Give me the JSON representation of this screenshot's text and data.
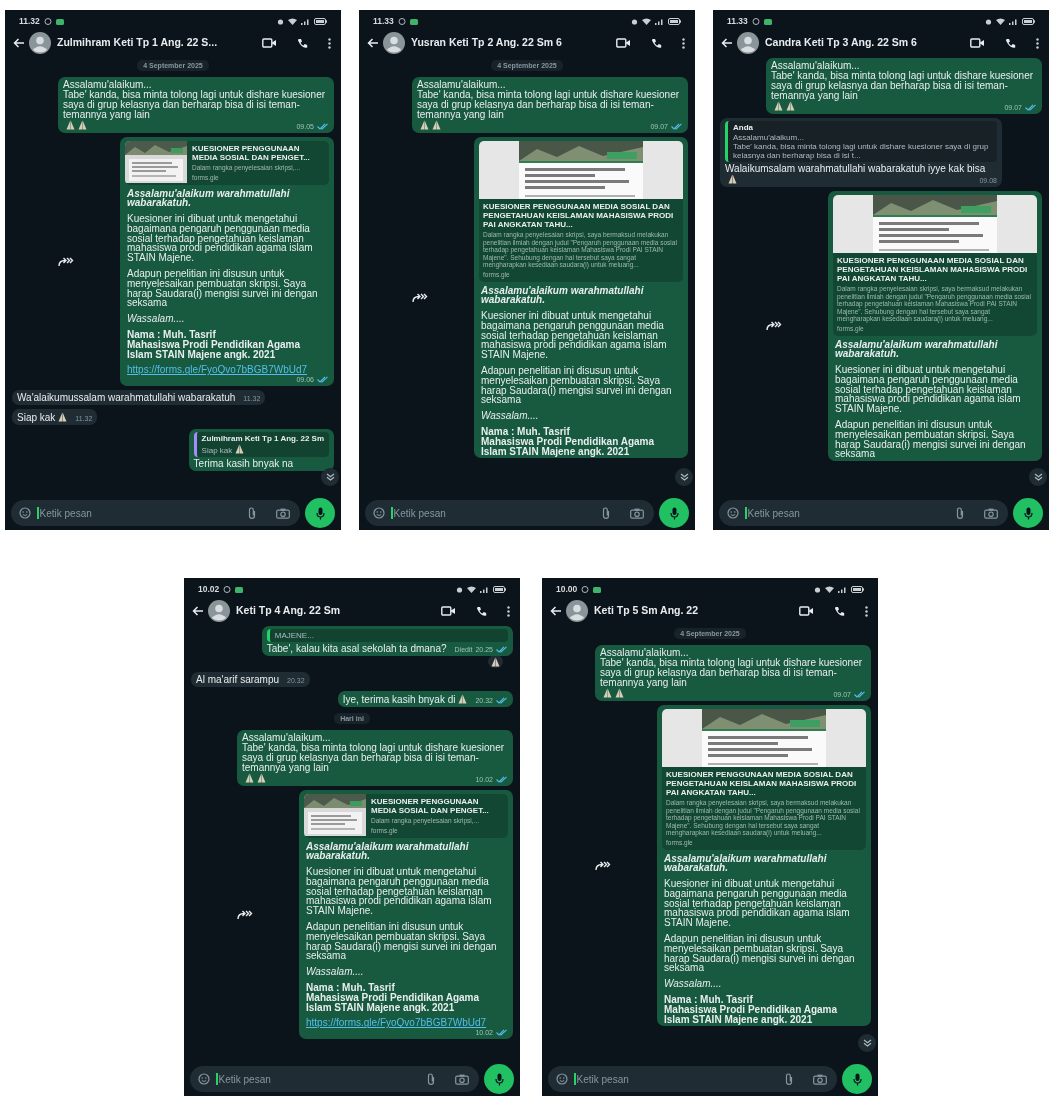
{
  "phones": [
    {
      "status_time": "11.32",
      "contact": "Zulmihram Keti Tp 1 Ang. 22 S...",
      "scroll_button": true,
      "placeholder": "Ketik pesan",
      "messages": [
        {
          "kind": "date",
          "text": "4 September 2025"
        },
        {
          "kind": "text",
          "outgoing": true,
          "text": "Assalamu'alaikum...\nTabe' kanda, bisa minta tolong lagi untuk dishare kuesioner saya di grup kelasnya dan berharap bisa di isi teman-temannya yang lain",
          "emojis": [
            {
              "kind": "pray"
            },
            {
              "kind": "pray"
            }
          ],
          "time": "09.05",
          "read": true
        },
        {
          "kind": "link",
          "outgoing": true,
          "forwarded": true,
          "preview": {
            "kind": "small",
            "title": "KUESIONER PENGGUNAAN MEDIA SOSIAL DAN PENGET...",
            "description": "Dalam rangka penyelesaian skripsi,...",
            "domain": "forms.gle"
          },
          "paragraphs": [
            {
              "kind": "greeting",
              "text": "Assalamu'alaikum warahmatullahi wabarakatuh."
            },
            {
              "kind": "body",
              "text": "Kuesioner ini dibuat untuk mengetahui bagaimana pengaruh penggunaan media sosial terhadap pengetahuan keislaman mahasiswa prodi pendidikan agama islam STAIN Majene."
            },
            {
              "kind": "body",
              "text": "Adapun penelitian ini disusun untuk menyelesaikan pembuatan skripsi. Saya harap Saudara(i) mengisi survei ini dengan seksama"
            },
            {
              "kind": "closing",
              "text": "Wassalam...."
            },
            {
              "kind": "signature",
              "text": "Nama : Muh. Tasrif\nMahasiswa Prodi Pendidikan Agama Islam STAIN Majene angk. 2021"
            }
          ],
          "url": "https://forms.gle/FyoQvo7bBGB7WbUd7",
          "time": "09.06",
          "read": true
        },
        {
          "kind": "text",
          "outgoing": false,
          "text": "Wa'alaikumussalam warahmatullahi wabarakatuh",
          "time": "11.32"
        },
        {
          "kind": "text",
          "outgoing": false,
          "text": "Siap kak",
          "emojis": [
            {
              "kind": "pray"
            }
          ],
          "time": "11.32"
        },
        {
          "kind": "text",
          "outgoing": true,
          "quote": {
            "author": "Zulmihram Keti Tp 1 Ang. 22 Sm",
            "text": "Siap kak",
            "emojis": [
              {
                "kind": "pray"
              }
            ],
            "color": "#a78bfa"
          },
          "text": "Terima kasih bnyak na"
        }
      ]
    },
    {
      "status_time": "11.33",
      "contact": "Yusran Keti Tp 2 Ang. 22 Sm 6",
      "scroll_button": true,
      "placeholder": "Ketik pesan",
      "messages": [
        {
          "kind": "date",
          "text": "4 September 2025"
        },
        {
          "kind": "text",
          "outgoing": true,
          "text": "Assalamu'alaikum...\nTabe' kanda, bisa minta tolong lagi untuk dishare kuesioner saya di grup kelasnya dan berharap bisa di isi teman-temannya yang lain",
          "emojis": [
            {
              "kind": "pray"
            },
            {
              "kind": "pray"
            }
          ],
          "time": "09.07",
          "read": true
        },
        {
          "kind": "link",
          "outgoing": true,
          "forwarded": true,
          "preview": {
            "kind": "large",
            "title": "KUESIONER PENGGUNAAN MEDIA SOSIAL DAN PENGETAHUAN KEISLAMAN MAHASISWA PRODI PAI ANGKATAN TAHU...",
            "description": "Dalam rangka penyelesaian skripsi, saya bermaksud melakukan penelitian ilmiah dengan judul \"Pengaruh penggunaan media sosial terhadap pengetahuan keislaman Mahasiswa Prodi PAI STAIN Majene\". Sehubung dengan hal tersebut saya sangat mengharapkan kesediaan saudara(i) untuk meluang...",
            "domain": "forms.gle"
          },
          "paragraphs": [
            {
              "kind": "greeting",
              "text": "Assalamu'alaikum warahmatullahi wabarakatuh."
            },
            {
              "kind": "body",
              "text": "Kuesioner ini dibuat untuk mengetahui bagaimana pengaruh penggunaan media sosial terhadap pengetahuan keislaman mahasiswa prodi pendidikan agama islam STAIN Majene."
            },
            {
              "kind": "body",
              "text": "Adapun penelitian ini disusun untuk menyelesaikan pembuatan skripsi. Saya harap Saudara(i) mengisi survei ini dengan seksama"
            },
            {
              "kind": "closing",
              "text": "Wassalam...."
            },
            {
              "kind": "signature",
              "text": "Nama : Muh. Tasrif\nMahasiswa Prodi Pendidikan Agama Islam STAIN Majene angk. 2021"
            }
          ]
        }
      ]
    },
    {
      "status_time": "11.33",
      "contact": "Candra Keti Tp 3 Ang. 22 Sm 6",
      "scroll_button": true,
      "placeholder": "Ketik pesan",
      "messages": [
        {
          "kind": "text",
          "outgoing": true,
          "text": "Assalamu'alaikum...\nTabe' kanda, bisa minta tolong lagi untuk dishare kuesioner saya di grup kelasnya dan berharap bisa di isi teman-temannya yang lain",
          "emojis": [
            {
              "kind": "pray"
            },
            {
              "kind": "pray"
            }
          ],
          "time": "09.07",
          "read": true
        },
        {
          "kind": "text",
          "outgoing": false,
          "quote": {
            "author": "Anda",
            "text": "Assalamu'alaikum...\nTabe' kanda, bisa minta tolong lagi untuk dishare kuesioner saya di grup kelasnya dan berharap bisa di isi t...",
            "color": "#25d366"
          },
          "text": "Walaikumsalam warahmatullahi wabarakatuh iyye kak bisa",
          "emojis": [
            {
              "kind": "pray"
            }
          ],
          "time": "09.08"
        },
        {
          "kind": "link",
          "outgoing": true,
          "forwarded": true,
          "preview": {
            "kind": "large",
            "title": "KUESIONER PENGGUNAAN MEDIA SOSIAL DAN PENGETAHUAN KEISLAMAN MAHASISWA PRODI PAI ANGKATAN TAHU...",
            "description": "Dalam rangka penyelesaian skripsi, saya bermaksud melakukan penelitian ilmiah dengan judul \"Pengaruh penggunaan media sosial terhadap pengetahuan keislaman Mahasiswa Prodi PAI STAIN Majene\". Sehubung dengan hal tersebut saya sangat mengharapkan kesediaan saudara(i) untuk meluang...",
            "domain": "forms.gle"
          },
          "paragraphs": [
            {
              "kind": "greeting",
              "text": "Assalamu'alaikum warahmatullahi wabarakatuh."
            },
            {
              "kind": "body",
              "text": "Kuesioner ini dibuat untuk mengetahui bagaimana pengaruh penggunaan media sosial terhadap pengetahuan keislaman mahasiswa prodi pendidikan agama islam STAIN Majene."
            },
            {
              "kind": "body",
              "text": "Adapun penelitian ini disusun untuk menyelesaikan pembuatan skripsi. Saya harap Saudara(i) mengisi survei ini dengan seksama"
            }
          ]
        }
      ]
    },
    {
      "status_time": "10.02",
      "contact": "Keti Tp 4 Ang. 22 Sm",
      "scroll_button": false,
      "placeholder": "Ketik pesan",
      "messages": [
        {
          "kind": "text",
          "outgoing": true,
          "quote": {
            "text": "MAJENE...",
            "color": "#25d366"
          },
          "text": "Tabe', kalau kita asal sekolah ta dmana?",
          "edited": "Diedit",
          "time": "20.25",
          "read": true,
          "reaction": {
            "kind": "pray"
          }
        },
        {
          "kind": "text",
          "outgoing": false,
          "text": "Al ma'arif sarampu",
          "time": "20.32"
        },
        {
          "kind": "text",
          "outgoing": true,
          "text": "Iye, terima kasih bnyak di",
          "emojis": [
            {
              "kind": "pray"
            }
          ],
          "time": "20.32",
          "read": true
        },
        {
          "kind": "date",
          "text": "Hari ini"
        },
        {
          "kind": "text",
          "outgoing": true,
          "text": "Assalamu'alaikum...\nTabe' kanda, bisa minta tolong lagi untuk dishare kuesioner saya di grup kelasnya dan berharap bisa di isi teman-temannya yang lain",
          "emojis": [
            {
              "kind": "pray"
            },
            {
              "kind": "pray"
            }
          ],
          "time": "10.02",
          "read": true
        },
        {
          "kind": "link",
          "outgoing": true,
          "forwarded": true,
          "preview": {
            "kind": "small",
            "title": "KUESIONER PENGGUNAAN MEDIA SOSIAL DAN PENGET...",
            "description": "Dalam rangka penyelesaian skripsi,...",
            "domain": "forms.gle"
          },
          "paragraphs": [
            {
              "kind": "greeting",
              "text": "Assalamu'alaikum warahmatullahi wabarakatuh."
            },
            {
              "kind": "body",
              "text": "Kuesioner ini dibuat untuk mengetahui bagaimana pengaruh penggunaan media sosial terhadap pengetahuan keislaman mahasiswa prodi pendidikan agama islam STAIN Majene."
            },
            {
              "kind": "body",
              "text": "Adapun penelitian ini disusun untuk menyelesaikan pembuatan skripsi. Saya harap Saudara(i) mengisi survei ini dengan seksama"
            },
            {
              "kind": "closing",
              "text": "Wassalam...."
            },
            {
              "kind": "signature",
              "text": "Nama : Muh. Tasrif\nMahasiswa Prodi Pendidikan Agama Islam STAIN Majene angk. 2021"
            }
          ],
          "url": "https://forms.gle/FyoQvo7bBGB7WbUd7",
          "time": "10.02",
          "read": true
        }
      ]
    },
    {
      "status_time": "10.00",
      "contact": "Keti Tp 5 Sm Ang. 22",
      "scroll_button": true,
      "placeholder": "Ketik pesan",
      "messages": [
        {
          "kind": "date",
          "text": "4 September 2025"
        },
        {
          "kind": "text",
          "outgoing": true,
          "text": "Assalamu'alaikum...\nTabe' kanda, bisa minta tolong lagi untuk dishare kuesioner saya di grup kelasnya dan berharap bisa di isi teman-temannya yang lain",
          "emojis": [
            {
              "kind": "pray"
            },
            {
              "kind": "pray"
            }
          ],
          "time": "09.07",
          "read": true
        },
        {
          "kind": "link",
          "outgoing": true,
          "forwarded": true,
          "preview": {
            "kind": "large",
            "title": "KUESIONER PENGGUNAAN MEDIA SOSIAL DAN PENGETAHUAN KEISLAMAN MAHASISWA PRODI PAI ANGKATAN TAHU...",
            "description": "Dalam rangka penyelesaian skripsi, saya bermaksud melakukan penelitian ilmiah dengan judul \"Pengaruh penggunaan media sosial terhadap pengetahuan keislaman Mahasiswa Prodi PAI STAIN Majene\". Sehubung dengan hal tersebut saya sangat mengharapkan kesediaan saudara(i) untuk meluang...",
            "domain": "forms.gle"
          },
          "paragraphs": [
            {
              "kind": "greeting",
              "text": "Assalamu'alaikum warahmatullahi wabarakatuh."
            },
            {
              "kind": "body",
              "text": "Kuesioner ini dibuat untuk mengetahui bagaimana pengaruh penggunaan media sosial terhadap pengetahuan keislaman mahasiswa prodi pendidikan agama islam STAIN Majene."
            },
            {
              "kind": "body",
              "text": "Adapun penelitian ini disusun untuk menyelesaikan pembuatan skripsi. Saya harap Saudara(i) mengisi survei ini dengan seksama"
            },
            {
              "kind": "closing",
              "text": "Wassalam...."
            },
            {
              "kind": "signature",
              "text": "Nama : Muh. Tasrif\nMahasiswa Prodi Pendidikan Agama Islam STAIN Majene angk. 2021"
            }
          ]
        }
      ]
    }
  ]
}
